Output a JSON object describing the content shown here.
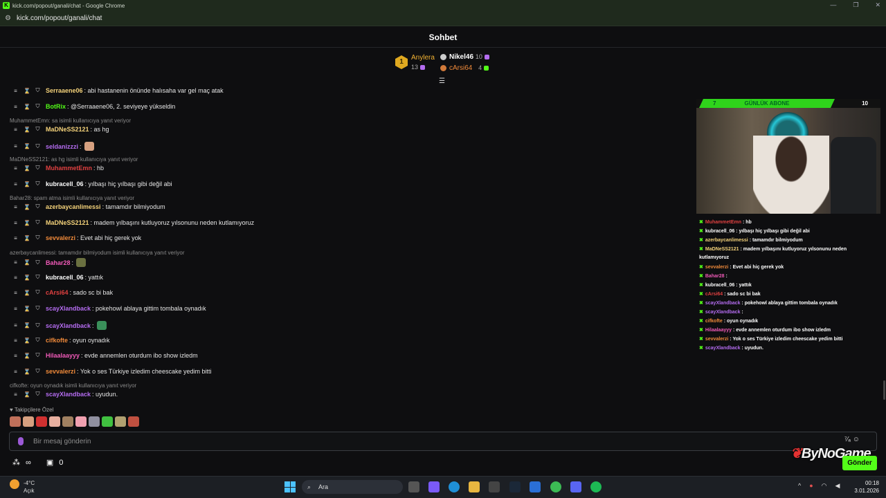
{
  "window": {
    "title": "kick.com/popout/ganali/chat - Google Chrome",
    "url": "kick.com/popout/ganali/chat",
    "min": "—",
    "max": "❐",
    "close": "✕"
  },
  "header": {
    "title": "Sohbet"
  },
  "top": {
    "first": {
      "rank": "1",
      "name": "Anylera",
      "count": "13"
    },
    "second": {
      "name": "Nikel46",
      "count": "10"
    },
    "third": {
      "name": "cArsi64",
      "count": "4"
    }
  },
  "colors": {
    "accent": "#53fc18",
    "gold": "#e0a920"
  },
  "messages": [
    {
      "user": "Serraaene06",
      "color": "#f4d27a",
      "text": ": abi hastanenin önünde halısaha var gel maç atak"
    },
    {
      "user": "BotRix",
      "color": "#53fc18",
      "text": ": @Serraaene06, 2. seviyeye yükseldin"
    },
    {
      "user": "MaDNeSS2121",
      "color": "#f4d27a",
      "text": ": as hg"
    },
    {
      "user": "seldanizzzi",
      "color": "#b46cf0",
      "text": ":"
    },
    {
      "user": "MuhammetEmn",
      "color": "#e04040",
      "text": ": hb"
    },
    {
      "user": "kubracell_06",
      "color": "#ffffff",
      "text": ": yılbaşı hiç yılbaşı gibi değil abi"
    },
    {
      "user": "azerbaycanlimessi",
      "color": "#f4d27a",
      "text": ": tamamdır bilmiyodum"
    },
    {
      "user": "MaDNeSS2121",
      "color": "#f4d27a",
      "text": ": madem yılbaşını kutluyoruz yılsonunu neden kutlamıyoruz"
    },
    {
      "user": "sevvalerzi",
      "color": "#f08a3a",
      "text": ": Evet abi hiç gerek yok"
    },
    {
      "user": "Bahar28",
      "color": "#f05ab8",
      "text": ":"
    },
    {
      "user": "kubracell_06",
      "color": "#ffffff",
      "text": ": yattık"
    },
    {
      "user": "cArsi64",
      "color": "#e04040",
      "text": ": sado sc bi bak"
    },
    {
      "user": "scayXlandback",
      "color": "#b46cf0",
      "text": ": pokehowl ablaya gittim tombala oynadık"
    },
    {
      "user": "scayXlandback",
      "color": "#b46cf0",
      "text": ":"
    },
    {
      "user": "cifkofte",
      "color": "#f08a3a",
      "text": ": oyun oynadık"
    },
    {
      "user": "Hilaalaayyy",
      "color": "#f05ab8",
      "text": ": evde annemlen oturdum ibo show izledm"
    },
    {
      "user": "sevvalerzi",
      "color": "#f08a3a",
      "text": ": Yok o ses Türkiye izledim cheescake yedim bitti"
    },
    {
      "user": "scayXlandback",
      "color": "#b46cf0",
      "text": ": uyudun."
    }
  ],
  "replies": [
    "MuhammetEmn: sa isimli kullanıcıya yanıt veriyor",
    "MaDNeSS2121: as hg isimli kullanıcıya yanıt veriyor",
    "Bahar28: spam atma isimli kullanıcıya yanıt veriyor",
    "azerbaycanlimessi: tamamdır bilmiyodum isimli kullanıcıya yanıt veriyor",
    "cifkofte: oyun oynadık isimli kullanıcıya yanıt veriyor"
  ],
  "overlay": {
    "left": "7",
    "label": "GÜNLÜK ABONE",
    "right": "10",
    "lines": [
      {
        "user": "MuhammetEmn",
        "color": "#e04040",
        "text": " : hb"
      },
      {
        "user": "kubracell_06",
        "color": "#ffffff",
        "text": " : yılbaşı hiç yılbaşı gibi değil abi"
      },
      {
        "user": "azerbaycanlimessi",
        "color": "#f4d27a",
        "text": " : tamamdır bilmiyodum"
      },
      {
        "user": "MaDNeSS2121",
        "color": "#f4d27a",
        "text": " : madem yılbaşını kutluyoruz yılsonunu neden"
      },
      {
        "user": "",
        "color": "#ffffff",
        "text": "kutlamıyoruz"
      },
      {
        "user": "sevvalerzi",
        "color": "#f08a3a",
        "text": " : Evet abi hiç gerek yok"
      },
      {
        "user": "Bahar28",
        "color": "#f05ab8",
        "text": " :"
      },
      {
        "user": "kubracell_06",
        "color": "#ffffff",
        "text": " : yattık"
      },
      {
        "user": "cArsi64",
        "color": "#e04040",
        "text": " : sado sc bi bak"
      },
      {
        "user": "scayXlandback",
        "color": "#b46cf0",
        "text": " : pokehowl ablaya gittim tombala oynadık"
      },
      {
        "user": "scayXlandback",
        "color": "#b46cf0",
        "text": " :"
      },
      {
        "user": "cifkofte",
        "color": "#f08a3a",
        "text": " : oyun oynadık"
      },
      {
        "user": "Hilaalaayyy",
        "color": "#f05ab8",
        "text": " : evde annemlen oturdum ibo show izledm"
      },
      {
        "user": "sevvalerzi",
        "color": "#f08a3a",
        "text": " : Yok o ses Türkiye izledim cheescake yedim bitti"
      },
      {
        "user": "scayXlandback",
        "color": "#b46cf0",
        "text": " : uyudun."
      }
    ]
  },
  "followers_only": "Takipçilere Özel",
  "input": {
    "placeholder": "Bir mesaj gönderin",
    "send": "Gönder"
  },
  "bottom": {
    "infinity": "∞",
    "count": "0"
  },
  "watermark": "ByNoGame",
  "taskbar": {
    "temp": "-4°C",
    "weather": "Açık",
    "search": "Ara",
    "time": "00:18",
    "date": "3.01.2026",
    "notif": "2"
  }
}
